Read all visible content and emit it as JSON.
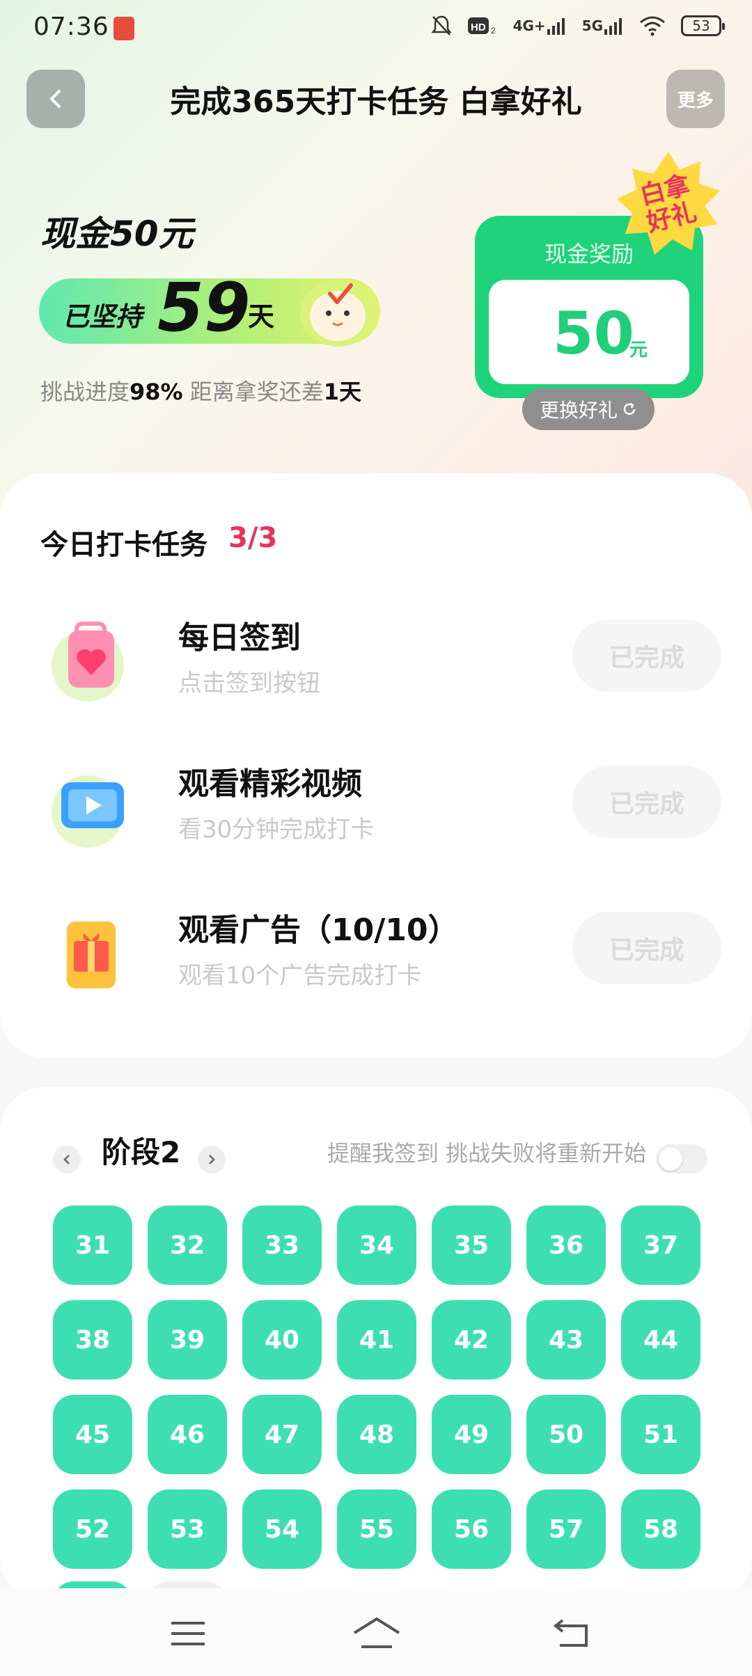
{
  "status_bar": {
    "time": "07:36",
    "net1": "4G+",
    "net2": "5G",
    "battery": "53",
    "icons": [
      "app-notification-icon",
      "do-not-disturb-icon",
      "hd-icon",
      "signal-icon",
      "wifi-icon",
      "battery-icon"
    ]
  },
  "header": {
    "title": "完成365天打卡任务 白拿好礼",
    "more_label": "更多"
  },
  "hero": {
    "cash_title": "现金50元",
    "persist_prefix": "已坚持",
    "persist_days": "59",
    "persist_suffix": "天",
    "progress_label": "挑战进度",
    "progress_value": "98%",
    "remaining_label": "距离拿奖还差",
    "remaining_value": "1天"
  },
  "reward": {
    "label": "现金奖励",
    "amount": "50",
    "unit": "元",
    "badge_line1": "白拿",
    "badge_line2": "好礼",
    "swap_label": "更换好礼"
  },
  "tasks": {
    "title": "今日打卡任务",
    "count": "3/3",
    "items": [
      {
        "title": "每日签到",
        "subtitle": "点击签到按钮",
        "button": "已完成",
        "icon": "heart-bag-icon"
      },
      {
        "title": "观看精彩视频",
        "subtitle": "看30分钟完成打卡",
        "button": "已完成",
        "icon": "video-play-icon"
      },
      {
        "title": "观看广告（10/10）",
        "subtitle": "观看10个广告完成打卡",
        "button": "已完成",
        "icon": "gift-box-icon"
      }
    ]
  },
  "stage": {
    "label": "阶段2",
    "remind_text": "提醒我签到 挑战失败将重新开始",
    "toggle_on": false,
    "days": [
      "31",
      "32",
      "33",
      "34",
      "35",
      "36",
      "37",
      "38",
      "39",
      "40",
      "41",
      "42",
      "43",
      "44",
      "45",
      "46",
      "47",
      "48",
      "49",
      "50",
      "51",
      "52",
      "53",
      "54",
      "55",
      "56",
      "57",
      "58"
    ]
  },
  "colors": {
    "accent_green": "#3ddfb1",
    "reward_green": "#1fd37a",
    "highlight_red": "#e8335d"
  }
}
